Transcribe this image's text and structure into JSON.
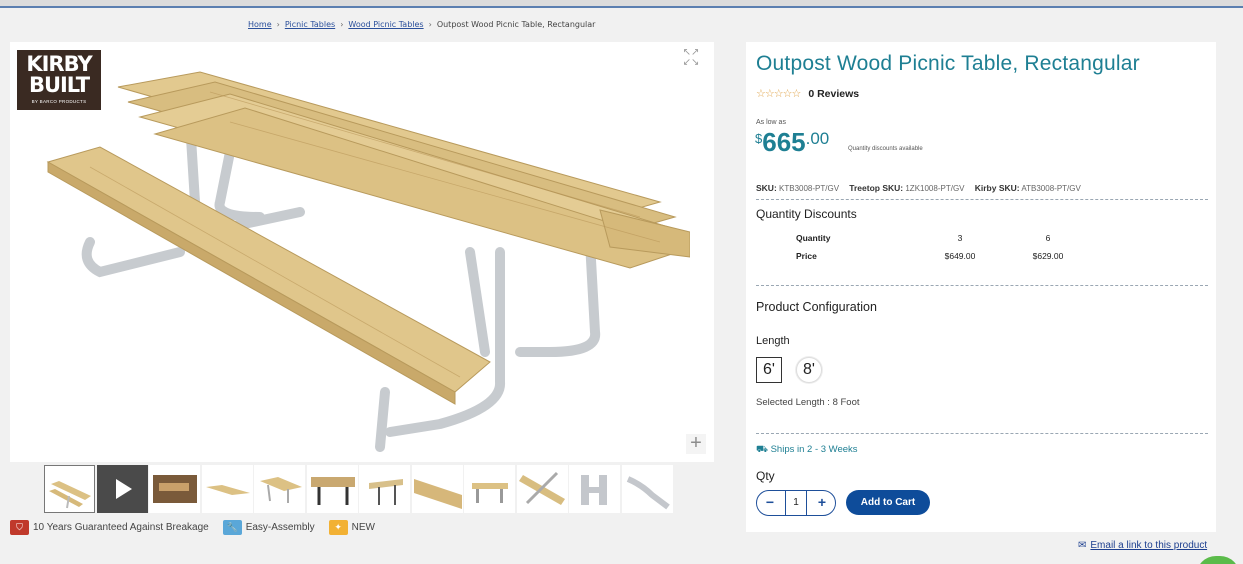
{
  "breadcrumb": {
    "items": [
      "Home",
      "Picnic Tables",
      "Wood Picnic Tables"
    ],
    "separator": "›",
    "current": "Outpost Wood Picnic Table, Rectangular"
  },
  "logo": {
    "line1": "KIRBY",
    "line2": "BUILT",
    "line3": "BY BARCO PRODUCTS"
  },
  "gallery": {
    "expand_icon": "expand-arrows-icon",
    "zoom_icon": "plus-icon",
    "zoom_glyph": "+",
    "thumbnail_count": 12,
    "active_thumbnail": 1
  },
  "badges": [
    {
      "icon": "shield-icon",
      "label": "10 Years Guaranteed Against Breakage",
      "color": "#c0392b"
    },
    {
      "icon": "wrench-icon",
      "label": "Easy-Assembly",
      "color": "#5aa7d8"
    },
    {
      "icon": "sparkle-icon",
      "label": "NEW",
      "color": "#f2b134"
    }
  ],
  "product": {
    "title": "Outpost Wood Picnic Table, Rectangular",
    "stars": "☆☆☆☆☆",
    "reviews": "0 Reviews",
    "as_low_as": "As low as",
    "price_currency": "$",
    "price_dollars": "665",
    "price_cents": ".00",
    "qty_discount_note": "Quantity discounts available",
    "skus": [
      {
        "label": "SKU:",
        "value": "KTB3008-PT/GV"
      },
      {
        "label": "Treetop SKU:",
        "value": "1ZK1008-PT/GV"
      },
      {
        "label": "Kirby SKU:",
        "value": "ATB3008-PT/GV"
      }
    ]
  },
  "quantity_discounts": {
    "title": "Quantity Discounts",
    "rows": [
      {
        "label": "Quantity",
        "a": "3",
        "b": "6"
      },
      {
        "label": "Price",
        "a": "$649.00",
        "b": "$629.00"
      }
    ]
  },
  "configuration": {
    "title": "Product Configuration",
    "length_label": "Length",
    "options": [
      "6'",
      "8'"
    ],
    "selected_option": "8'",
    "selected_text": "Selected Length : 8 Foot"
  },
  "shipping": {
    "text": "Ships in 2 - 3 Weeks",
    "icon": "truck-icon"
  },
  "cart": {
    "qty_label": "Qty",
    "qty_value": "1",
    "minus": "−",
    "plus": "+",
    "add_label": "Add to Cart"
  },
  "email_link": {
    "text": "Email a link to this product",
    "icon": "envelope-icon"
  },
  "colors": {
    "accent": "#1e7f93",
    "button": "#0e4c9a"
  }
}
